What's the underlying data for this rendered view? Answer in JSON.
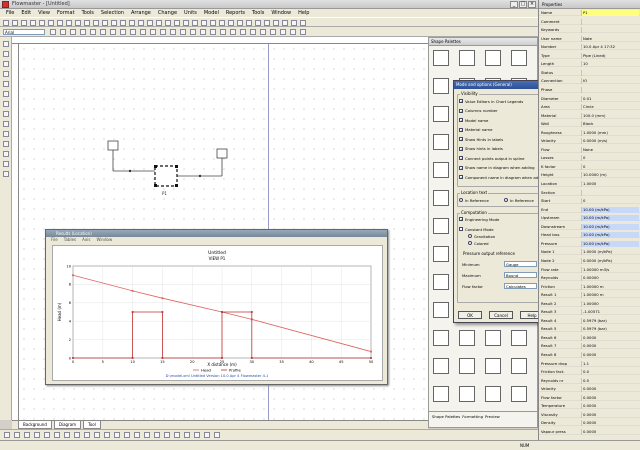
{
  "menu": [
    "File",
    "Edit",
    "View",
    "Format",
    "Tools",
    "Selection",
    "Arrange",
    "Change",
    "Units",
    "Model",
    "Reports",
    "Tools",
    "Window",
    "Help"
  ],
  "toolbar": {
    "font_value": "Arial"
  },
  "tabs": {
    "sheets": [
      "Background",
      "Diagram",
      "Tool"
    ],
    "palette_tabs": [
      "Shape Palettes",
      "Formatting",
      "Preview"
    ]
  },
  "canvas": {
    "block_label": "P1"
  },
  "plot": {
    "window_title": "Results (Location)",
    "menu": [
      "File",
      "Tables",
      "Axis",
      "Window"
    ],
    "chart_title": "Untitled",
    "chart_subtitle": "VIEW P1",
    "xlabel": "X distance (m)",
    "ylabel": "Head (m)",
    "legend": [
      "Head",
      "Profile"
    ],
    "footer": "D:\\model.xml   Untitled   Version 10.0 Apr 4   Flowmaster 4.1"
  },
  "chart_data": {
    "type": "line",
    "xlabel": "X distance (m)",
    "ylabel": "Head (m)",
    "xlim": [
      0,
      50
    ],
    "ylim": [
      0,
      10
    ],
    "x_ticks": [
      0,
      5,
      10,
      15,
      20,
      25,
      30,
      35,
      40,
      45,
      50
    ],
    "y_ticks": [
      0,
      2,
      4,
      6,
      8,
      10
    ],
    "series": [
      {
        "name": "Head",
        "color": "#e06060",
        "x": [
          0,
          10,
          15,
          25,
          30,
          50
        ],
        "y": [
          9.0,
          7.3,
          6.5,
          5.0,
          4.2,
          0.7
        ]
      },
      {
        "name": "Profile",
        "color": "#c03030",
        "x": [
          0,
          10,
          10,
          15,
          15,
          25,
          25,
          30,
          30,
          50
        ],
        "y": [
          0,
          0,
          5.0,
          5.0,
          0,
          0,
          5.0,
          5.0,
          0,
          0
        ]
      }
    ]
  },
  "palette": {
    "title": "Shape Palettes"
  },
  "dialog": {
    "title": "Mode and options (General)",
    "visibility_label": "Visibility",
    "checkboxes": [
      "Value Editors in Chart Legends",
      "Columns number",
      "Model name",
      "Material name",
      "Show Hints in labels",
      "Show hints in labels",
      "Connect points output in spline",
      "Show name in diagram when adding",
      "Component name in diagram when adding"
    ],
    "location_label": "Location text",
    "location_opts": [
      "In Reference",
      "In Reference"
    ],
    "computation_label": "Computation",
    "engineering": "Engineering Mode",
    "constant_mode": "Constant Mode",
    "radio_opts": [
      "Gravitation",
      "Colored"
    ],
    "pressure_label": "Pressure output reference",
    "rows": [
      {
        "label": "Minimum",
        "value": "Gauge"
      },
      {
        "label": "Maximum",
        "value": "Bound"
      },
      {
        "label": "Flow factor",
        "value": "Calculates"
      }
    ],
    "buttons": [
      "OK",
      "Cancel",
      "Help"
    ]
  },
  "props": {
    "title": "Properties",
    "rows": [
      {
        "k": "Name",
        "v": "P1"
      },
      {
        "k": "Comment",
        "v": ""
      },
      {
        "k": "Keywords",
        "v": ""
      },
      {
        "k": "User name",
        "v": "Nate"
      },
      {
        "k": "Number",
        "v": "10.0 Apr 4 17:32"
      },
      {
        "k": "Type",
        "v": "Pipe (Lined)"
      },
      {
        "k": "Length",
        "v": "10"
      },
      {
        "k": "Status",
        "v": ""
      },
      {
        "k": "Connection",
        "v": "IO"
      },
      {
        "k": "Phase",
        "v": ""
      },
      {
        "k": "Diameter",
        "v": "0.01"
      },
      {
        "k": "Area",
        "v": "Circle"
      },
      {
        "k": "Material",
        "v": "100.0 (mm)"
      },
      {
        "k": "Wall",
        "v": "Black"
      },
      {
        "k": "Roughness",
        "v": "1.0000 (mm)"
      },
      {
        "k": "Velocity",
        "v": "0.0000 (m/s)"
      },
      {
        "k": "Flow",
        "v": "None"
      },
      {
        "k": "Losses",
        "v": "0"
      },
      {
        "k": "K factor",
        "v": "0"
      },
      {
        "k": "Height",
        "v": "10.0000 (m)"
      },
      {
        "k": "Location",
        "v": "1.0000"
      },
      {
        "k": "Section",
        "v": ""
      },
      {
        "k": "Start",
        "v": "0"
      },
      {
        "k": "End",
        "v": "10.00 (m/kPa)"
      },
      {
        "k": "Upstream",
        "v": "10.00 (m/kPa)"
      },
      {
        "k": "Downstream",
        "v": "10.00 (m/kPa)"
      },
      {
        "k": "Head loss",
        "v": "10.00 (m/kPa)"
      },
      {
        "k": "Pressure",
        "v": "10.00 (m/kPa)"
      },
      {
        "k": "Node 1",
        "v": "1.0000 (m/kPa)"
      },
      {
        "k": "Node 2",
        "v": "0.0000 (m/kPa)"
      },
      {
        "k": "Flow rate",
        "v": "1.00000 m3/s"
      },
      {
        "k": "Reynolds",
        "v": "0.00000"
      },
      {
        "k": "Friction",
        "v": "1.00000 m"
      },
      {
        "k": "Result 1",
        "v": "1.00000 m"
      },
      {
        "k": "Result 2",
        "v": "1.00000"
      },
      {
        "k": "Result 3",
        "v": "-1.00571"
      },
      {
        "k": "Result 4",
        "v": "0.5979 (bar)"
      },
      {
        "k": "Result 5",
        "v": "0.5979 (bar)"
      },
      {
        "k": "Result 6",
        "v": "0.0000"
      },
      {
        "k": "Result 7",
        "v": "0.0000"
      },
      {
        "k": "Result 8",
        "v": "0.0000"
      },
      {
        "k": "Pressure drop",
        "v": "1.1"
      },
      {
        "k": "Friction fact.",
        "v": "0.0"
      },
      {
        "k": "Reynolds nr",
        "v": "0.0"
      },
      {
        "k": "Velocity",
        "v": "0.0000"
      },
      {
        "k": "Flow factor",
        "v": "0.0000"
      },
      {
        "k": "Temperature",
        "v": "0.0000"
      },
      {
        "k": "Viscosity",
        "v": "0.0000"
      },
      {
        "k": "Density",
        "v": "0.0000"
      },
      {
        "k": "Vapour press",
        "v": "0.0000"
      }
    ]
  },
  "status": {
    "text": "NUM"
  }
}
